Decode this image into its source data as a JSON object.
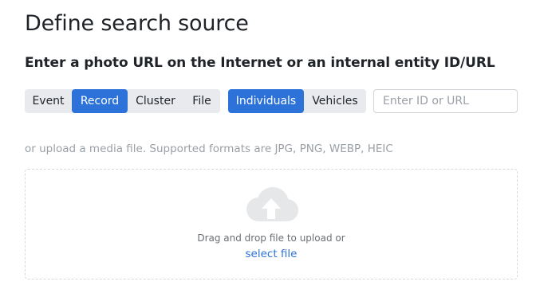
{
  "header": {
    "title": "Define search source",
    "subtitle": "Enter a photo URL on the Internet or an internal entity ID/URL"
  },
  "entity_type": {
    "options": [
      "Event",
      "Record",
      "Cluster",
      "File"
    ],
    "selected": "Record"
  },
  "object_type": {
    "options": [
      "Individuals",
      "Vehicles"
    ],
    "selected": "Individuals"
  },
  "id_input": {
    "value": "",
    "placeholder": "Enter ID or URL"
  },
  "upload": {
    "hint": "or upload a media file. Supported formats are JPG, PNG, WEBP, HEIC",
    "drop_text": "Drag and drop file to upload or",
    "select_link": "select file",
    "icon": "cloud-upload-icon"
  },
  "colors": {
    "accent": "#2c72d9",
    "segment_bg": "#e8eaed",
    "icon_gray": "#e6e7e9",
    "muted_text": "#9aa0a6"
  }
}
